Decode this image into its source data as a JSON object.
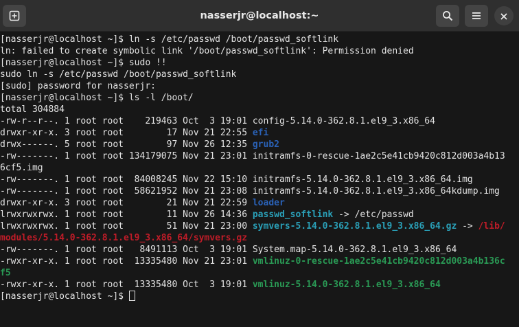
{
  "window": {
    "title": "nasserjr@localhost:~",
    "buttons": [
      "new-tab-icon",
      "search-icon",
      "menu-icon",
      "close-icon"
    ]
  },
  "colors": {
    "directory": "#2a62b8",
    "symlink": "#2aa0b8",
    "executable": "#2a9a55",
    "broken": "#c01c28",
    "text": "#e3e3e3",
    "background": "#171717"
  },
  "terminal": {
    "lines": [
      [
        {
          "t": "[nasserjr@localhost ~]$ ln -s /etc/passwd /boot/passwd_softlink"
        }
      ],
      [
        {
          "t": "ln: failed to create symbolic link '/boot/passwd_softlink': Permission denied"
        }
      ],
      [
        {
          "t": "[nasserjr@localhost ~]$ sudo !!"
        }
      ],
      [
        {
          "t": "sudo ln -s /etc/passwd /boot/passwd_softlink"
        }
      ],
      [
        {
          "t": "[sudo] password for nasserjr:"
        }
      ],
      [
        {
          "t": "[nasserjr@localhost ~]$ ls -l /boot/"
        }
      ],
      [
        {
          "t": "total 304884"
        }
      ],
      [
        {
          "t": "-rw-r--r--. 1 root root    219463 Oct  3 19:01 config-5.14.0-362.8.1.el9_3.x86_64"
        }
      ],
      [
        {
          "t": "drwxr-xr-x. 3 root root        17 Nov 21 22:55 "
        },
        {
          "t": "efi",
          "c": "dir"
        }
      ],
      [
        {
          "t": "drwx------. 5 root root        97 Nov 26 12:35 "
        },
        {
          "t": "grub2",
          "c": "dir"
        }
      ],
      [
        {
          "t": "-rw-------. 1 root root 134179075 Nov 21 23:01 initramfs-0-rescue-1ae2c5e41cb9420c812d003a4b13"
        }
      ],
      [
        {
          "t": "6cf5.img"
        }
      ],
      [
        {
          "t": "-rw-------. 1 root root  84008245 Nov 22 15:10 initramfs-5.14.0-362.8.1.el9_3.x86_64.img"
        }
      ],
      [
        {
          "t": "-rw-------. 1 root root  58621952 Nov 21 23:08 initramfs-5.14.0-362.8.1.el9_3.x86_64kdump.img"
        }
      ],
      [
        {
          "t": "drwxr-xr-x. 3 root root        21 Nov 21 22:59 "
        },
        {
          "t": "loader",
          "c": "dir"
        }
      ],
      [
        {
          "t": "lrwxrwxrwx. 1 root root        11 Nov 26 14:36 "
        },
        {
          "t": "passwd_softlink",
          "c": "link"
        },
        {
          "t": " -> /etc/passwd"
        }
      ],
      [
        {
          "t": "lrwxrwxrwx. 1 root root        51 Nov 21 23:00 "
        },
        {
          "t": "symvers-5.14.0-362.8.1.el9_3.x86_64.gz",
          "c": "link"
        },
        {
          "t": " -> "
        },
        {
          "t": "/lib/",
          "c": "broken"
        }
      ],
      [
        {
          "t": "modules/5.14.0-362.8.1.el9_3.x86_64/symvers.gz",
          "c": "broken"
        }
      ],
      [
        {
          "t": "-rw-------. 1 root root   8491113 Oct  3 19:01 System.map-5.14.0-362.8.1.el9_3.x86_64"
        }
      ],
      [
        {
          "t": "-rwxr-xr-x. 1 root root  13335480 Nov 21 23:01 "
        },
        {
          "t": "vmlinuz-0-rescue-1ae2c5e41cb9420c812d003a4b136c",
          "c": "exec"
        }
      ],
      [
        {
          "t": "f5",
          "c": "exec"
        }
      ],
      [
        {
          "t": "-rwxr-xr-x. 1 root root  13335480 Oct  3 19:01 "
        },
        {
          "t": "vmlinuz-5.14.0-362.8.1.el9_3.x86_64",
          "c": "exec"
        }
      ],
      [
        {
          "t": "[nasserjr@localhost ~]$ "
        },
        {
          "cursor": true
        }
      ]
    ]
  }
}
